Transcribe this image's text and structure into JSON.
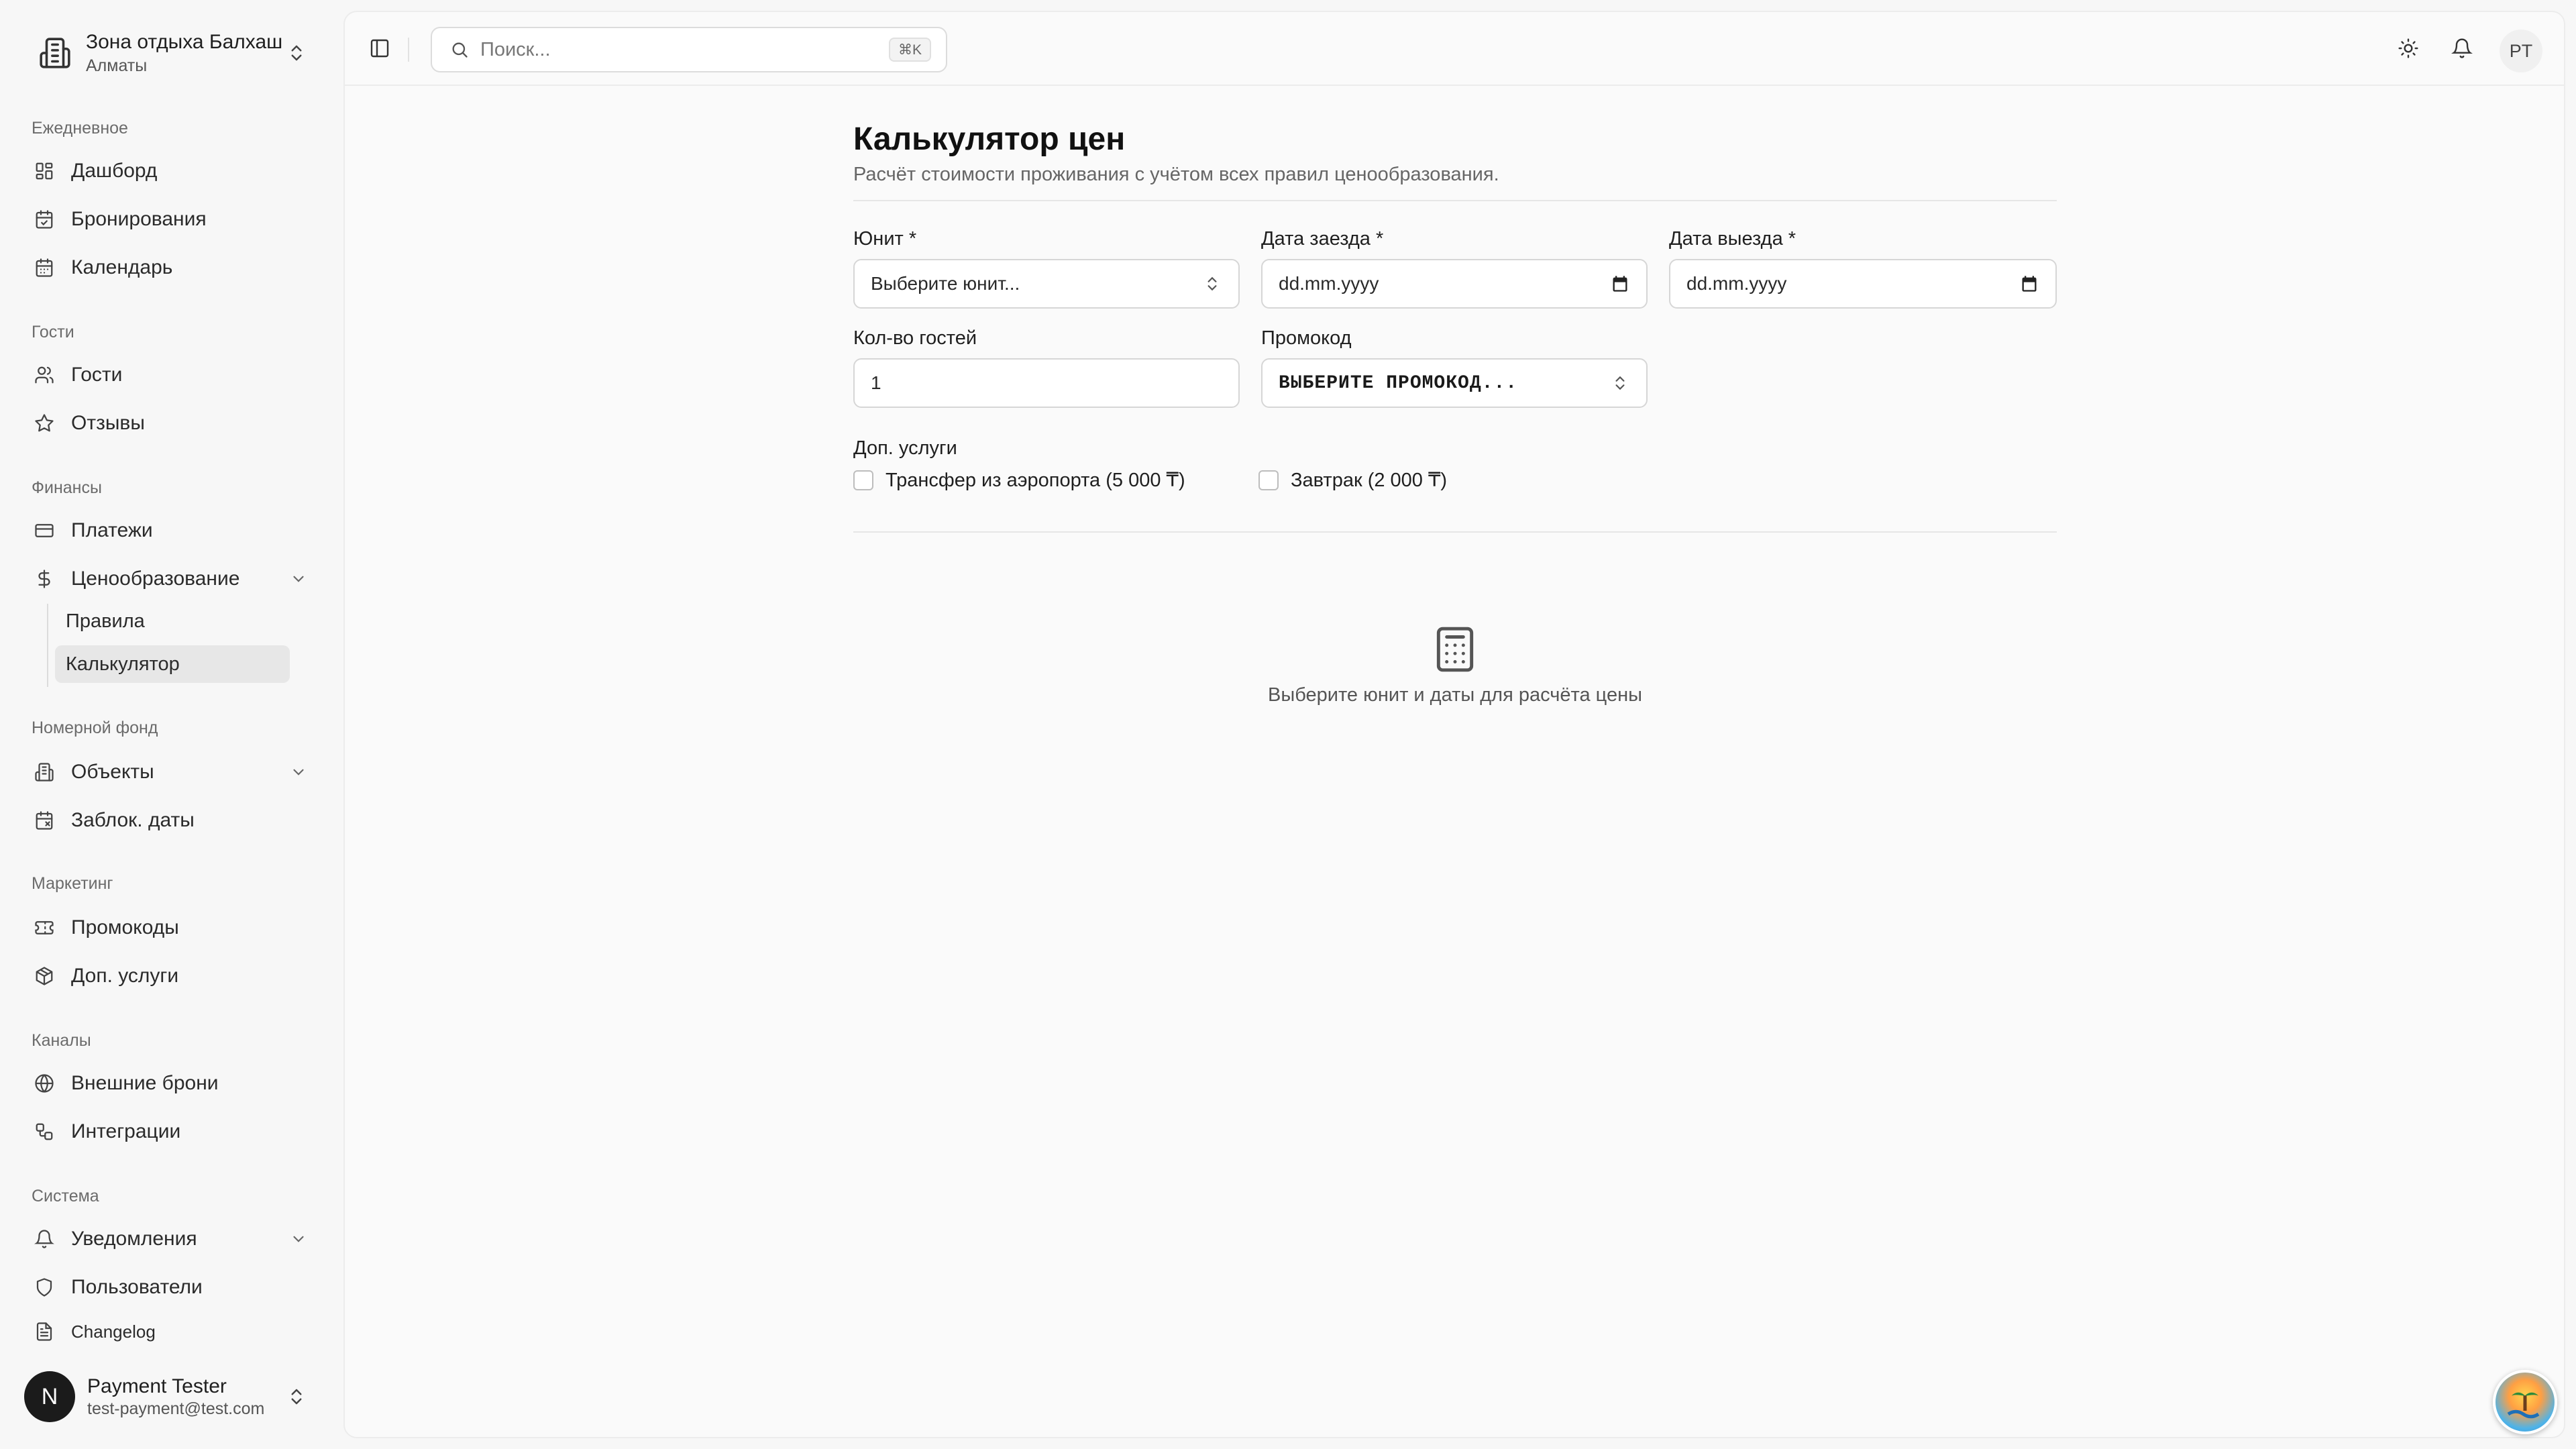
{
  "org": {
    "name": "Зона отдыха Балхаш",
    "city": "Алматы"
  },
  "nav": {
    "sections": {
      "daily": "Ежедневное",
      "guests": "Гости",
      "finance": "Финансы",
      "rooms": "Номерной фонд",
      "marketing": "Маркетинг",
      "channels": "Каналы",
      "system": "Система"
    },
    "items": {
      "dashboard": "Дашборд",
      "bookings": "Бронирования",
      "calendar": "Календарь",
      "guests": "Гости",
      "reviews": "Отзывы",
      "payments": "Платежи",
      "pricing": "Ценообразование",
      "pricing_rules": "Правила",
      "pricing_calculator": "Калькулятор",
      "properties": "Объекты",
      "blocked_dates": "Заблок. даты",
      "promocodes": "Промокоды",
      "extras": "Доп. услуги",
      "external_bookings": "Внешние брони",
      "integrations": "Интеграции",
      "notifications": "Уведомления",
      "users": "Пользователи",
      "changelog": "Changelog"
    },
    "active": "pricing_calculator"
  },
  "user": {
    "initial": "N",
    "name": "Payment Tester",
    "email": "test-payment@test.com"
  },
  "topbar": {
    "search_placeholder": "Поиск...",
    "search_shortcut": "⌘K",
    "avatar_initials": "PT"
  },
  "page": {
    "title": "Калькулятор цен",
    "description": "Расчёт стоимости проживания с учётом всех правил ценообразования."
  },
  "form": {
    "unit": {
      "label": "Юнит *",
      "value": "Выберите юнит..."
    },
    "checkin": {
      "label": "Дата заезда *",
      "value": "dd.mm.yyyy"
    },
    "checkout": {
      "label": "Дата выезда *",
      "value": "dd.mm.yyyy"
    },
    "guests": {
      "label": "Кол-во гостей",
      "value": "1"
    },
    "promo": {
      "label": "Промокод",
      "value": "ВЫБЕРИТЕ ПРОМОКОД..."
    },
    "extras": {
      "label": "Доп. услуги",
      "options": [
        {
          "label": "Трансфер из аэропорта (5 000 ₸)",
          "checked": false
        },
        {
          "label": "Завтрак (2 000 ₸)",
          "checked": false
        }
      ]
    }
  },
  "empty_state": {
    "text": "Выберите юнит и даты для расчёта цены",
    "icon": "calculator-icon"
  },
  "colors": {
    "sidebar_bg": "#f7f7f7",
    "active_item_bg": "#e7e7e7",
    "main_bg": "#fafafa",
    "text": "#1a1a1a"
  }
}
